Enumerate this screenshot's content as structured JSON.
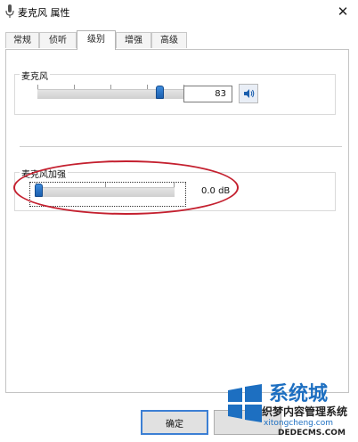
{
  "window": {
    "title": "麦克风 属性"
  },
  "tabs": [
    {
      "label": "常规"
    },
    {
      "label": "侦听"
    },
    {
      "label": "级别",
      "active": true
    },
    {
      "label": "增强"
    },
    {
      "label": "高级"
    }
  ],
  "microphone": {
    "label": "麦克风",
    "value": "83",
    "level_percent": 83,
    "speaker_icon": "speaker-icon"
  },
  "boost": {
    "label": "麦克风加强",
    "value": "0.0 dB",
    "level_percent": 0
  },
  "buttons": {
    "ok_label": "确定"
  },
  "watermark": {
    "brand": "系统城",
    "cms_name": "织梦内容管理系统",
    "domain_cn": "xitongcheng.com",
    "domain_en": "DEDECMS.COM"
  },
  "colors": {
    "accent": "#1b5fae",
    "highlight": "#c4202f",
    "watermark": "#1d6fc1"
  }
}
